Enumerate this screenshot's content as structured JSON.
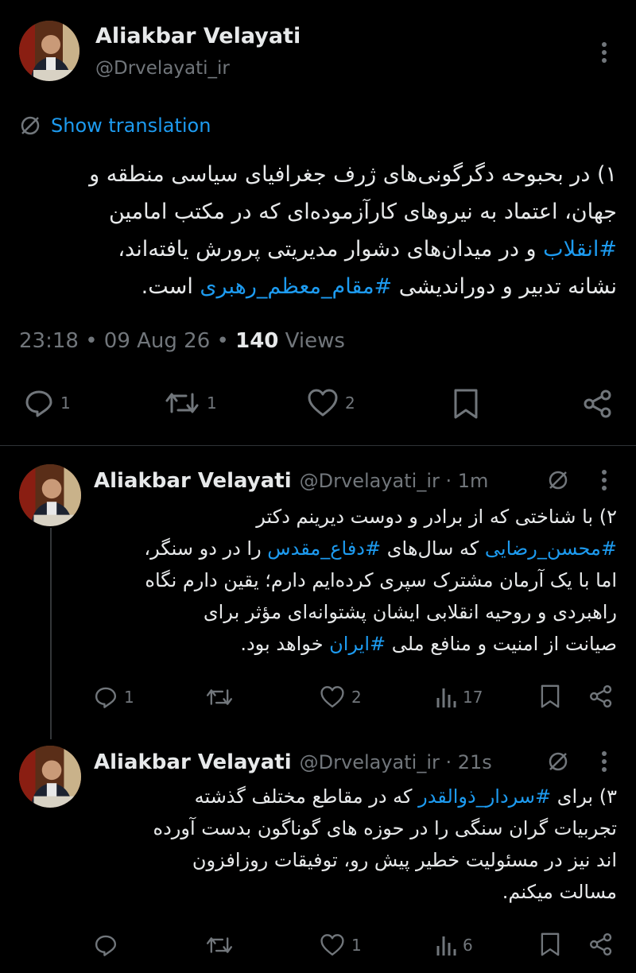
{
  "main_tweet": {
    "name": "Aliakbar Velayati",
    "handle": "@Drvelayati_ir",
    "translate_label": "Show translation",
    "text_lines": [
      [
        "۱) در بحبوحه دگرگونی‌های ژرف جغرافیای سیاسی منطقه و"
      ],
      [
        "جهان، اعتماد به نیروهای کارآزموده‌ای که در مکتب امامین"
      ],
      [
        "#انقلاب",
        " و در میدان‌های دشوار مدیریتی پرورش یافته‌اند،"
      ],
      [
        "نشانه تدبیر و دوراندیشی ",
        "#مقام_معظم_رهبری",
        " است."
      ]
    ],
    "time": "23:18 • 09 Aug 26 •",
    "views_count": "140",
    "views_label": "Views",
    "reply_count": "1",
    "retweet_count": "1",
    "like_count": "2"
  },
  "reply1": {
    "name": "Aliakbar Velayati",
    "handle": "@Drvelayati_ir · 1m",
    "text_lines": [
      [
        "۲) با شناختی که از برادر و دوست دیرینم دکتر"
      ],
      [
        "#محسن_رضایی",
        " که سال‌های ",
        "#دفاع_مقدس",
        " را در دو سنگر،"
      ],
      [
        "اما با یک آرمان مشترک سپری کرده‌ایم دارم؛ یقین دارم نگاه"
      ],
      [
        "راهبردی و روحیه انقلابی ایشان پشتوانه‌ای مؤثر برای"
      ],
      [
        "صیانت از امنیت و منافع ملی ",
        "#ایران",
        " خواهد بود."
      ]
    ],
    "reply_count": "1",
    "like_count": "2",
    "views_count": "17"
  },
  "reply2": {
    "name": "Aliakbar Velayati",
    "handle": "@Drvelayati_ir · 21s",
    "text_lines": [
      [
        "۳) برای ",
        "#سردار_ذوالقدر",
        " که در مقاطع مختلف گذشته"
      ],
      [
        "تجربیات گران سنگی را در حوزه های گوناگون بدست آورده"
      ],
      [
        "اند نیز در مسئولیت خطیر پیش رو، توفیقات روزافزون"
      ],
      [
        "مسالت میکنم."
      ]
    ],
    "like_count": "1",
    "views_count": "6"
  },
  "icons": [
    "more-icon",
    "translate-icon",
    "reply-icon",
    "retweet-icon",
    "like-icon",
    "bookmark-icon",
    "share-icon",
    "views-icon"
  ],
  "colors": {
    "background": "#000000",
    "text": "#e7e9ea",
    "muted": "#71767b",
    "accent": "#1d9bf0",
    "divider": "#2f3336"
  }
}
